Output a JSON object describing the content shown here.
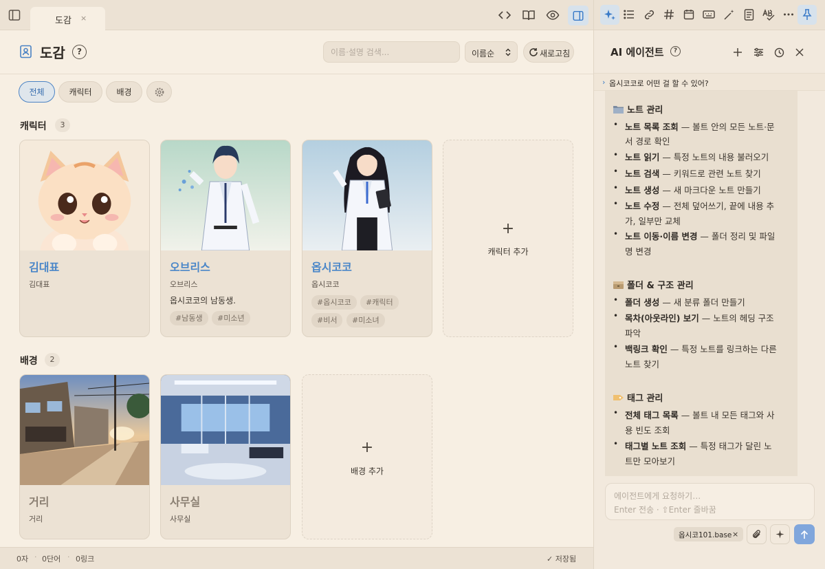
{
  "tab": {
    "title": "도감",
    "close": "×"
  },
  "header": {
    "title": "도감",
    "help": "?",
    "search_placeholder": "이름·설명 검색...",
    "sort_label": "이름순",
    "refresh_label": "새로고침"
  },
  "filters": {
    "all": "전체",
    "character": "캐릭터",
    "background": "배경"
  },
  "characters": {
    "title": "캐릭터",
    "count": "3",
    "items": [
      {
        "name": "김대표",
        "sub": "김대표",
        "desc": "",
        "tags": []
      },
      {
        "name": "오브리스",
        "sub": "오브리스",
        "desc": "옵시코코의 남동생.",
        "tags": [
          "#남동생",
          "#미소년"
        ]
      },
      {
        "name": "옵시코코",
        "sub": "옵시코코",
        "desc": "",
        "tags": [
          "#옵시코코",
          "#캐릭터",
          "#비서",
          "#미소녀"
        ]
      }
    ],
    "add": {
      "plus": "+",
      "label": "캐릭터 추가"
    }
  },
  "backgrounds": {
    "title": "배경",
    "count": "2",
    "items": [
      {
        "name": "거리",
        "sub": "거리"
      },
      {
        "name": "사무실",
        "sub": "사무실"
      }
    ],
    "add": {
      "plus": "+",
      "label": "배경 추가"
    }
  },
  "status": {
    "chars": "0자",
    "words": "0단어",
    "links": "0링크",
    "saved": "✓ 저장됨"
  },
  "panel": {
    "title": "AI 에이전트",
    "help": "?",
    "suggestion": "옵시코코로 어떤 걸 할 수 있어?",
    "sections": [
      {
        "title": "노트 관리",
        "items": [
          {
            "bold": "노트 목록 조회",
            "rest": " — 볼트 안의 모든 노트·문",
            "cont": "서 경로 확인"
          },
          {
            "bold": "노트 읽기",
            "rest": " — 특정 노트의 내용 불러오기",
            "cont": ""
          },
          {
            "bold": "노트 검색",
            "rest": " — 키워드로 관련 노트 찾기",
            "cont": ""
          },
          {
            "bold": "노트 생성",
            "rest": " — 새 마크다운 노트 만들기",
            "cont": ""
          },
          {
            "bold": "노트 수정",
            "rest": " — 전체 덮어쓰기, 끝에 내용 추",
            "cont": "가, 일부만 교체"
          },
          {
            "bold": "노트 이동·이름 변경",
            "rest": " — 폴더 정리 및 파일",
            "cont": "명 변경"
          }
        ]
      },
      {
        "title": "폴더 & 구조 관리",
        "items": [
          {
            "bold": "폴더 생성",
            "rest": " — 새 분류 폴더 만들기",
            "cont": ""
          },
          {
            "bold": "목차(아웃라인) 보기",
            "rest": " — 노트의 헤딩 구조",
            "cont": "파악"
          },
          {
            "bold": "백링크 확인",
            "rest": " — 특정 노트를 링크하는 다른",
            "cont": "노트 찾기"
          }
        ]
      },
      {
        "title": "태그 관리",
        "items": [
          {
            "bold": "전체 태그 목록",
            "rest": " — 볼트 내 모든 태그와 사",
            "cont": "용 빈도 조회"
          },
          {
            "bold": "태그별 노트 조회",
            "rest": " — 특정 태그가 달린 노",
            "cont": "트만 모아보기"
          }
        ]
      }
    ],
    "input_placeholder": "에이전트에게 요청하기…",
    "input_hint": "Enter 전송 · ⇧Enter 줄바꿈",
    "attachment": "옵시코101.base",
    "attachment_close": "×"
  },
  "colors": {
    "accent": "#4a86c8",
    "background": "#f7efe3",
    "panel": "#f2e9dd",
    "send": "#80a6dc"
  },
  "icons": [
    "sidebar-toggle-icon",
    "code-icon",
    "book-icon",
    "eye-icon",
    "panel-right-icon",
    "sparkles-icon",
    "list-icon",
    "link-icon",
    "hash-icon",
    "calendar-icon",
    "keyboard-icon",
    "magic-wand-icon",
    "document-icon",
    "spellcheck-icon",
    "more-icon",
    "pin-icon",
    "plus-icon",
    "sliders-icon",
    "history-icon",
    "close-icon",
    "paperclip-icon",
    "sparkle-icon",
    "arrow-up-icon"
  ]
}
